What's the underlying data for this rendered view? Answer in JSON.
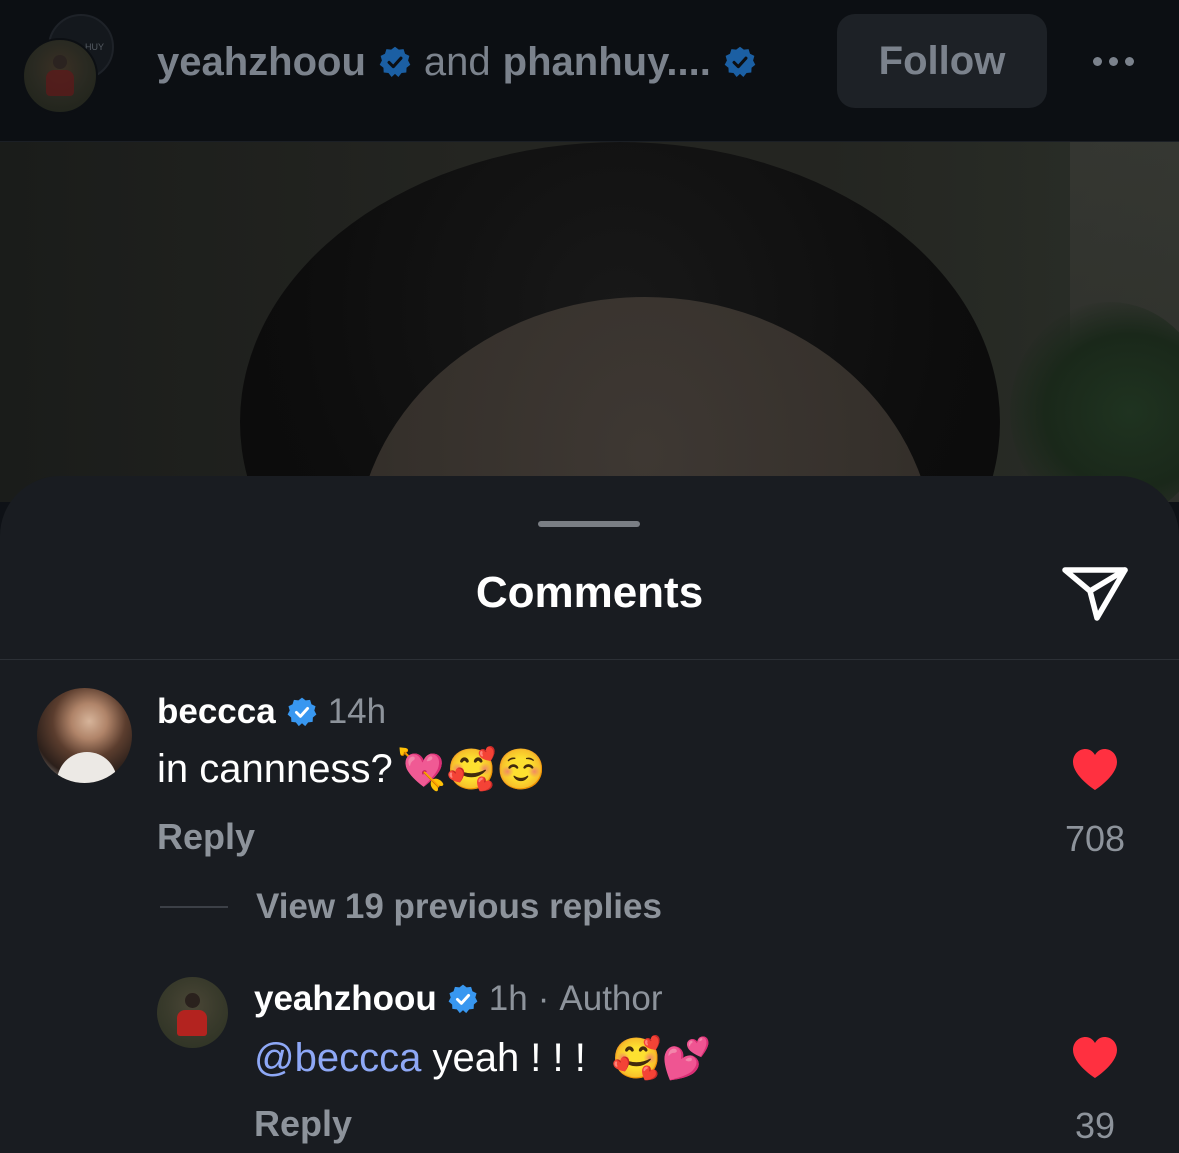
{
  "header": {
    "avatar_back_text": "HUY",
    "user1": "yeahzhoou",
    "connector": "and",
    "user2": "phanhuy....",
    "follow_label": "Follow"
  },
  "sheet": {
    "title": "Comments"
  },
  "comments": [
    {
      "username": "beccca",
      "time": "14h",
      "text": "in cannness?",
      "emojis": "💘🥰☺️",
      "reply_label": "Reply",
      "likes": "708"
    },
    {
      "username": "yeahzhoou",
      "time": "1h",
      "separator": "·",
      "author_tag": "Author",
      "mention": "@beccca",
      "text": " yeah ! ! !",
      "emojis": "🥰💕",
      "reply_label": "Reply",
      "likes": "39"
    }
  ],
  "view_replies_label": "View 19 previous replies",
  "colors": {
    "verified_blue": "#3897f0",
    "heart_red": "#ff3040",
    "mention_blue": "#8ea8f6"
  }
}
